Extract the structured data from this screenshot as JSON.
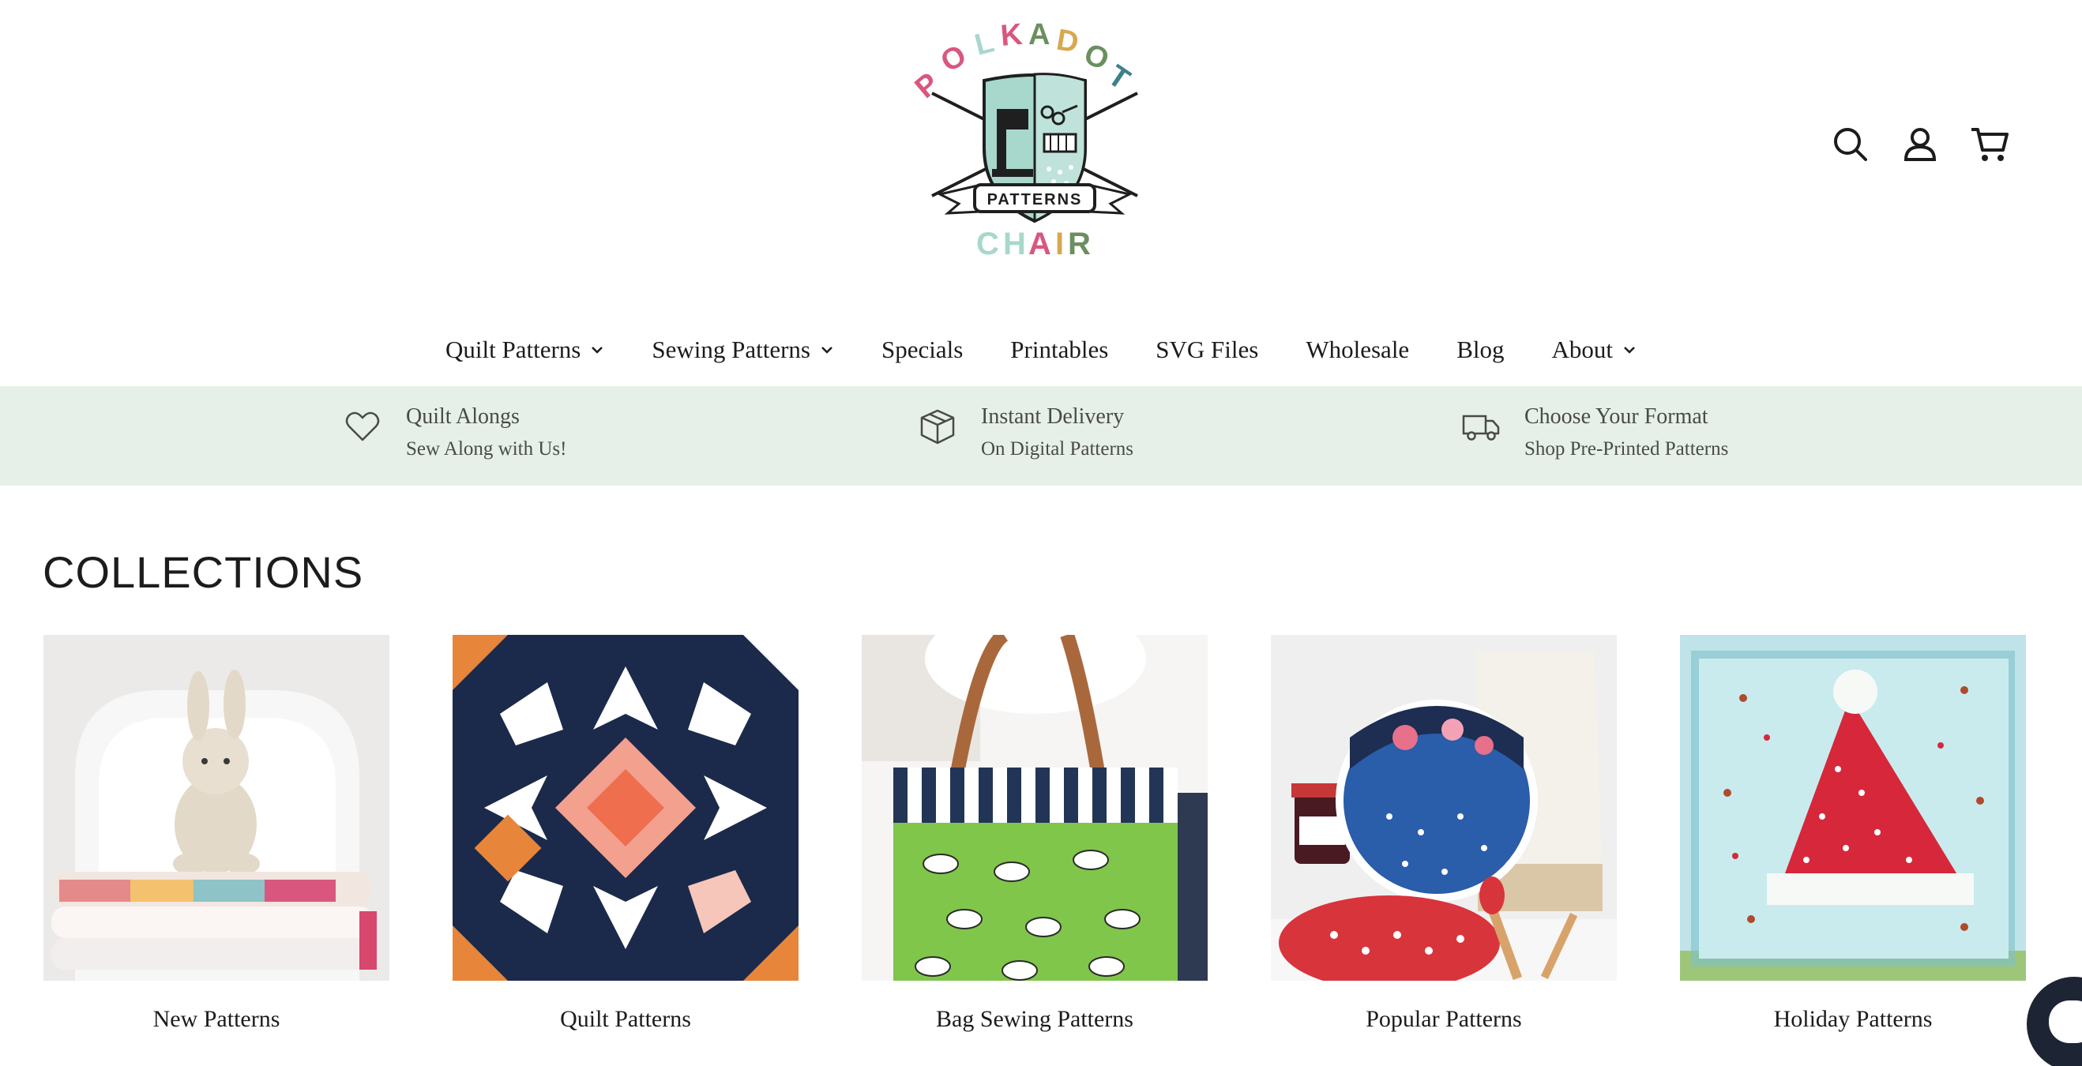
{
  "brand": {
    "name_top": "POLKADOT",
    "name_bottom": "CHAIR",
    "ribbon": "PATTERNS",
    "colors": {
      "pink": "#d9577f",
      "mint": "#a8d7cc",
      "green": "#6b8f5f",
      "gold": "#d6a94d",
      "teal": "#3f7f8c",
      "dark": "#1f1f1f"
    }
  },
  "header": {
    "icons": {
      "search": "search-icon",
      "account": "account-icon",
      "cart": "cart-icon"
    }
  },
  "nav": {
    "items": [
      {
        "label": "Quilt Patterns",
        "dropdown": true
      },
      {
        "label": "Sewing Patterns",
        "dropdown": true
      },
      {
        "label": "Specials",
        "dropdown": false
      },
      {
        "label": "Printables",
        "dropdown": false
      },
      {
        "label": "SVG Files",
        "dropdown": false
      },
      {
        "label": "Wholesale",
        "dropdown": false
      },
      {
        "label": "Blog",
        "dropdown": false
      },
      {
        "label": "About",
        "dropdown": true
      }
    ]
  },
  "benefits": {
    "background": "#e6f0e8",
    "items": [
      {
        "icon": "heart-icon",
        "title": "Quilt Alongs",
        "subtitle": "Sew Along with Us!"
      },
      {
        "icon": "box-icon",
        "title": "Instant Delivery",
        "subtitle": "On Digital Patterns"
      },
      {
        "icon": "truck-icon",
        "title": "Choose Your Format",
        "subtitle": "Shop Pre-Printed Patterns"
      }
    ]
  },
  "collections": {
    "heading": "COLLECTIONS",
    "items": [
      {
        "label": "New Patterns"
      },
      {
        "label": "Quilt Patterns"
      },
      {
        "label": "Bag Sewing Patterns"
      },
      {
        "label": "Popular Patterns"
      },
      {
        "label": "Holiday Patterns"
      }
    ]
  }
}
